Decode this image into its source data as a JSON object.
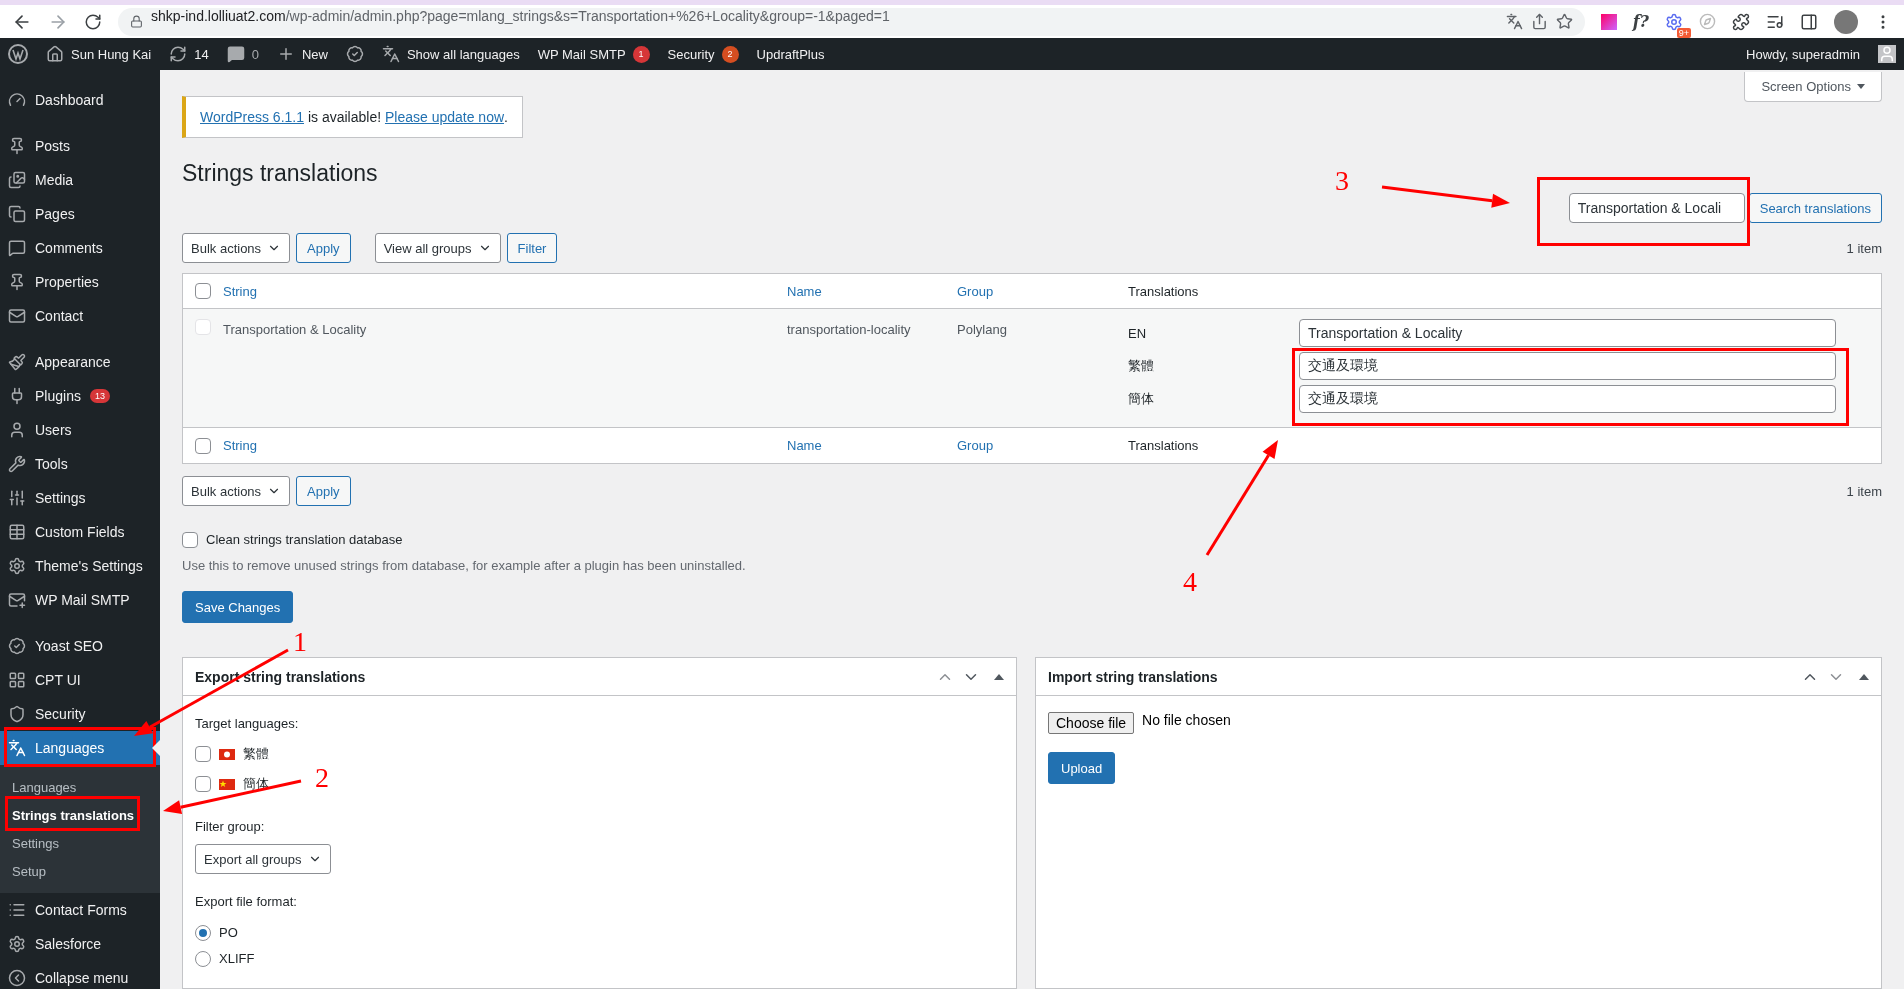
{
  "browser": {
    "url_host": "shkp-ind.lolliuat2.com",
    "url_path": "/wp-admin/admin.php?page=mlang_strings&s=Transportation+%26+Locality&group=-1&paged=1",
    "extension_text": "f?",
    "extension_badge": "9+"
  },
  "admin_bar": {
    "items": [
      {
        "kind": "site",
        "label": "Sun Hung Kai"
      },
      {
        "kind": "updates",
        "label": "14"
      },
      {
        "kind": "comments",
        "label": "0"
      },
      {
        "kind": "new",
        "label": "New"
      },
      {
        "kind": "yoast"
      },
      {
        "kind": "languages",
        "label": "Show all languages"
      },
      {
        "kind": "plain",
        "label": "WP Mail SMTP",
        "badge": "1",
        "color": "#d63638"
      },
      {
        "kind": "plain",
        "label": "Security",
        "badge": "2",
        "color": "#d54e21"
      },
      {
        "kind": "plain",
        "label": "UpdraftPlus"
      }
    ],
    "greeting": "Howdy, superadmin"
  },
  "sidebar": {
    "groups": [
      {
        "items": [
          {
            "label": "Dashboard",
            "selected": false
          }
        ]
      },
      {
        "items": [
          {
            "label": "Posts",
            "selected": false
          },
          {
            "label": "Media",
            "selected": false
          },
          {
            "label": "Pages",
            "selected": false
          },
          {
            "label": "Comments",
            "selected": false
          },
          {
            "label": "Properties",
            "selected": false
          },
          {
            "label": "Contact",
            "selected": false
          }
        ]
      },
      {
        "items": [
          {
            "label": "Appearance",
            "selected": false
          },
          {
            "label": "Plugins",
            "selected": false,
            "badge": "13"
          },
          {
            "label": "Users",
            "selected": false
          },
          {
            "label": "Tools",
            "selected": false
          },
          {
            "label": "Settings",
            "selected": false
          },
          {
            "label": "Custom Fields",
            "selected": false
          },
          {
            "label": "Theme's Settings",
            "selected": false
          },
          {
            "label": "WP Mail SMTP",
            "selected": false
          }
        ]
      },
      {
        "items": [
          {
            "label": "Yoast SEO",
            "selected": false
          },
          {
            "label": "CPT UI",
            "selected": false
          },
          {
            "label": "Security",
            "selected": false
          },
          {
            "label": "Languages",
            "selected": true,
            "children": [
              {
                "label": "Languages",
                "selected": false
              },
              {
                "label": "Strings translations",
                "selected": true
              },
              {
                "label": "Settings",
                "selected": false
              },
              {
                "label": "Setup",
                "selected": false
              }
            ]
          },
          {
            "label": "Contact Forms",
            "selected": false
          },
          {
            "label": "Salesforce",
            "selected": false
          },
          {
            "label": "Collapse menu",
            "selected": false
          }
        ]
      }
    ]
  },
  "screen_options": "Screen Options",
  "notice": {
    "link": "WordPress 6.1.1",
    "text": "is available!",
    "action": "Please update now",
    "end": "."
  },
  "title": "Strings translations",
  "search": {
    "value": "Transportation & Locali",
    "button": "Search translations"
  },
  "top_actions": {
    "bulk": "Bulk actions",
    "apply": "Apply",
    "groups": "View all groups",
    "filter": "Filter",
    "count": "1 item"
  },
  "table": {
    "header_checked": false,
    "footer_checked": false,
    "columns": [
      "String",
      "Name",
      "Group",
      "Translations"
    ],
    "rows": [
      {
        "checked": false,
        "string": "Transportation & Locality",
        "name": "transportation-locality",
        "group": "Polylang",
        "translations": [
          {
            "lang": "EN",
            "value": "Transportation & Locality"
          },
          {
            "lang": "繁體",
            "value": "交通及環境"
          },
          {
            "lang": "簡体",
            "value": "交通及環境"
          }
        ]
      }
    ],
    "footer_columns": [
      "String",
      "Name",
      "Group",
      "Translations"
    ]
  },
  "bottom_actions": {
    "bulk": "Bulk actions",
    "apply": "Apply",
    "count": "1 item"
  },
  "clean": {
    "label": "Clean strings translation database",
    "checked": false,
    "description": "Use this to remove unused strings from database, for example after a plugin has been uninstalled."
  },
  "save": "Save Changes",
  "export": {
    "title": "Export string translations",
    "target_label": "Target languages:",
    "languages": [
      {
        "kind": "hk",
        "label": "繁體",
        "checked": false
      },
      {
        "kind": "cn",
        "label": "簡体",
        "checked": false
      }
    ],
    "filter_label": "Filter group:",
    "filter_value": "Export all groups",
    "format_label": "Export file format:",
    "formats": [
      {
        "label": "PO",
        "selected": true
      },
      {
        "label": "XLIFF",
        "selected": false
      }
    ]
  },
  "import": {
    "title": "Import string translations",
    "choose": "Choose file",
    "no_file": "No file chosen",
    "upload": "Upload"
  },
  "callouts": [
    {
      "number": "1"
    },
    {
      "number": "2"
    },
    {
      "number": "3"
    },
    {
      "number": "4"
    }
  ]
}
